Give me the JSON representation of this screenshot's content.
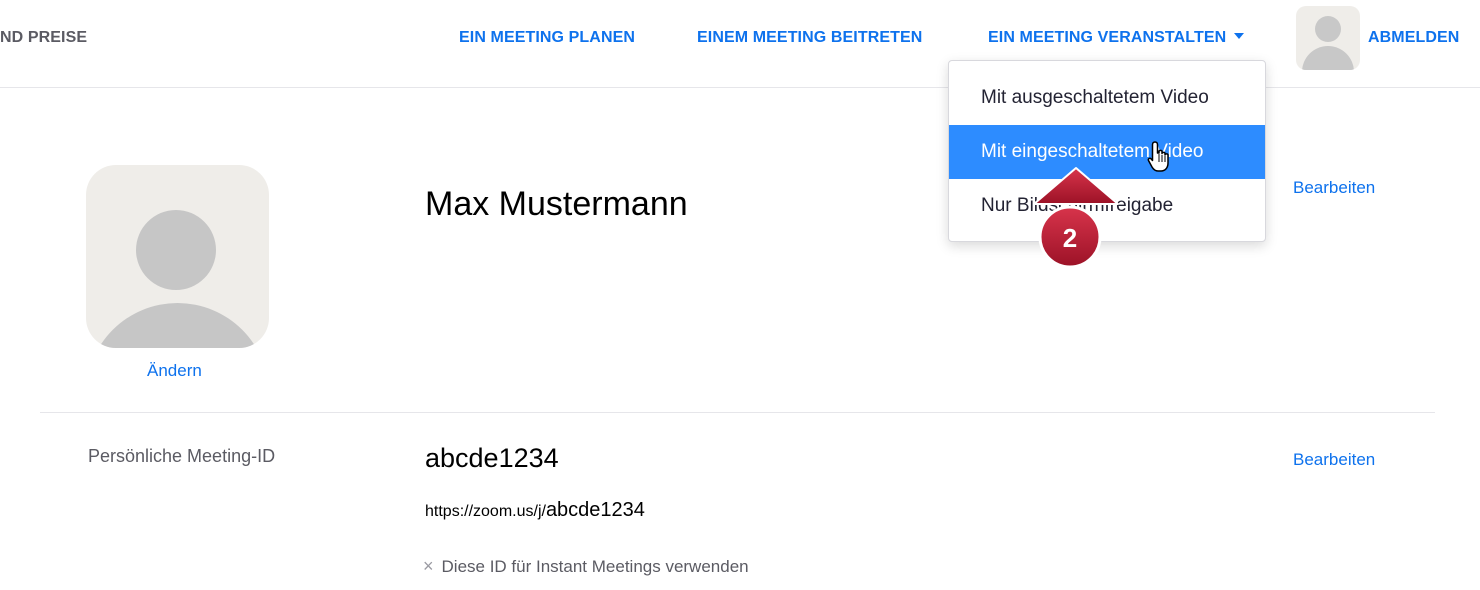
{
  "nav": {
    "pricing_partial": "ND PREISE",
    "plan": "EIN MEETING PLANEN",
    "join": "EINEM MEETING BEITRETEN",
    "host": "EIN MEETING VERANSTALTEN",
    "signout": "ABMELDEN"
  },
  "dropdown": {
    "items": [
      {
        "label": "Mit ausgeschaltetem Video",
        "active": false
      },
      {
        "label": "Mit eingeschaltetem Video",
        "active": true
      },
      {
        "label": "Nur Bildschirmfreigabe",
        "active": false
      }
    ]
  },
  "marker": {
    "number": "2",
    "color": "#b3162e"
  },
  "profile": {
    "change_link": "Ändern",
    "name": "Max Mustermann",
    "edit_link": "Bearbeiten"
  },
  "meeting": {
    "label": "Persönliche Meeting-ID",
    "id": "abcde1234",
    "url_prefix": "https://zoom.us/j/",
    "url_id": "abcde1234",
    "edit_link": "Bearbeiten",
    "option_icon": "x-icon",
    "option": "Diese ID für Instant Meetings verwenden"
  },
  "colors": {
    "accent": "#0e72ed",
    "menu_highlight": "#2d8cff",
    "marker": "#b3162e"
  }
}
